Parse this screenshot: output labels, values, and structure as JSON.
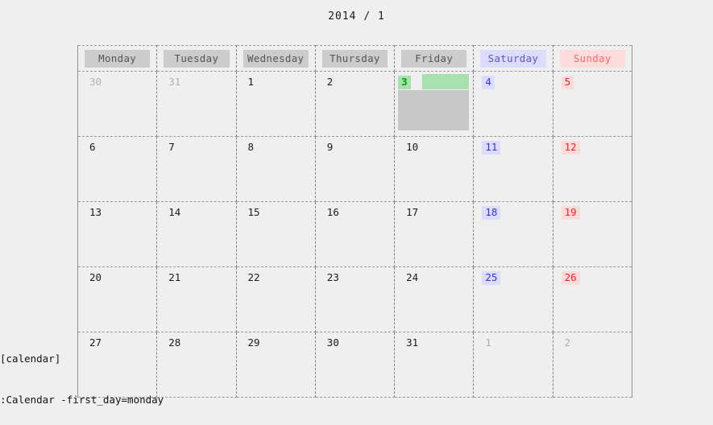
{
  "title": "2014 /  1",
  "calendar": {
    "weekday_headers": [
      {
        "label": "Monday",
        "kind": "weekday"
      },
      {
        "label": "Tuesday",
        "kind": "weekday"
      },
      {
        "label": "Wednesday",
        "kind": "weekday"
      },
      {
        "label": "Thursday",
        "kind": "weekday"
      },
      {
        "label": "Friday",
        "kind": "weekday"
      },
      {
        "label": "Saturday",
        "kind": "saturday"
      },
      {
        "label": "Sunday",
        "kind": "sunday"
      }
    ],
    "weeks": [
      [
        {
          "day": "30",
          "kind": "muted"
        },
        {
          "day": "31",
          "kind": "muted"
        },
        {
          "day": "1",
          "kind": "weekday"
        },
        {
          "day": "2",
          "kind": "weekday"
        },
        {
          "day": "3",
          "kind": "today"
        },
        {
          "day": "4",
          "kind": "saturday"
        },
        {
          "day": "5",
          "kind": "sunday"
        }
      ],
      [
        {
          "day": "6",
          "kind": "weekday"
        },
        {
          "day": "7",
          "kind": "weekday"
        },
        {
          "day": "8",
          "kind": "weekday"
        },
        {
          "day": "9",
          "kind": "weekday"
        },
        {
          "day": "10",
          "kind": "weekday"
        },
        {
          "day": "11",
          "kind": "saturday"
        },
        {
          "day": "12",
          "kind": "sunday"
        }
      ],
      [
        {
          "day": "13",
          "kind": "weekday"
        },
        {
          "day": "14",
          "kind": "weekday"
        },
        {
          "day": "15",
          "kind": "weekday"
        },
        {
          "day": "16",
          "kind": "weekday"
        },
        {
          "day": "17",
          "kind": "weekday"
        },
        {
          "day": "18",
          "kind": "saturday"
        },
        {
          "day": "19",
          "kind": "sunday"
        }
      ],
      [
        {
          "day": "20",
          "kind": "weekday"
        },
        {
          "day": "21",
          "kind": "weekday"
        },
        {
          "day": "22",
          "kind": "weekday"
        },
        {
          "day": "23",
          "kind": "weekday"
        },
        {
          "day": "24",
          "kind": "weekday"
        },
        {
          "day": "25",
          "kind": "saturday"
        },
        {
          "day": "26",
          "kind": "sunday"
        }
      ],
      [
        {
          "day": "27",
          "kind": "weekday"
        },
        {
          "day": "28",
          "kind": "weekday"
        },
        {
          "day": "29",
          "kind": "weekday"
        },
        {
          "day": "30",
          "kind": "weekday"
        },
        {
          "day": "31",
          "kind": "weekday"
        },
        {
          "day": "1",
          "kind": "muted"
        },
        {
          "day": "2",
          "kind": "muted"
        }
      ]
    ]
  },
  "footer": {
    "line1": "[calendar]",
    "line2": ":Calendar -first_day=monday"
  },
  "colors": {
    "page_background": "#efefef",
    "header_pill": "#cccccc",
    "saturday_background": "#dcdcfe",
    "saturday_text": "#5555dd",
    "sunday_background": "#fedcdc",
    "sunday_text": "#fb6a6a",
    "today_background": "#a8e0b0",
    "today_text": "#00a000",
    "selection_block": "#c8c8c8",
    "muted_text": "#b0b0b0",
    "grid_vertical": "#8c7a8c",
    "grid_horizontal": "#9a9a9a"
  }
}
